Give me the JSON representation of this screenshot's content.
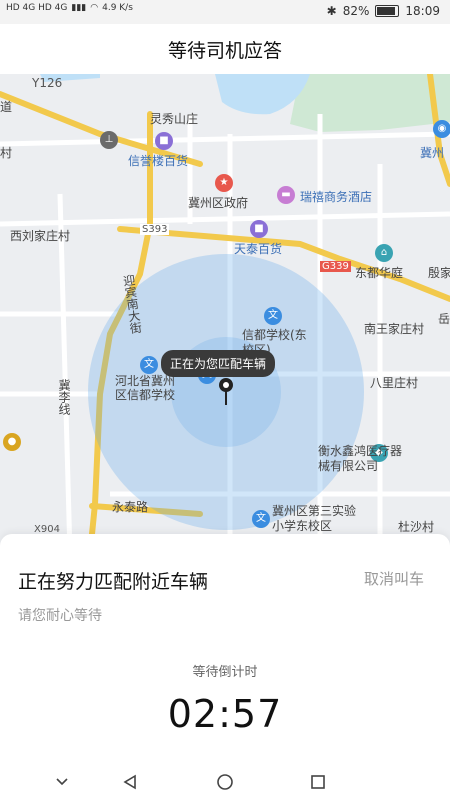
{
  "status_bar": {
    "network_left": "HD 4G HD 4G",
    "speed": "4.9 K/s",
    "battery_percent": "82%",
    "battery_level": 0.82,
    "time": "18:09"
  },
  "header": {
    "title": "等待司机应答"
  },
  "map": {
    "tooltip": "正在为您匹配车辆",
    "labels": [
      {
        "text": "Y126",
        "cls": "road"
      },
      {
        "text": "灵秀山庄",
        "cls": "dark"
      },
      {
        "text": "信誉楼百货",
        "cls": "blue"
      },
      {
        "text": "冀州区政府",
        "cls": "dark"
      },
      {
        "text": "瑞禧商务酒店",
        "cls": "blue"
      },
      {
        "text": "西刘家庄村",
        "cls": "dark"
      },
      {
        "text": "S393",
        "cls": "road"
      },
      {
        "text": "天泰百货",
        "cls": "blue"
      },
      {
        "text": "G339",
        "cls": "road"
      },
      {
        "text": "东都华庭",
        "cls": "dark"
      },
      {
        "text": "殷家",
        "cls": "dark"
      },
      {
        "text": "迎宾南大街",
        "cls": "dark"
      },
      {
        "text": "信都学校(东校区)",
        "cls": "dark"
      },
      {
        "text": "南王家庄村",
        "cls": "dark"
      },
      {
        "text": "河北省冀州区信都学校",
        "cls": "dark"
      },
      {
        "text": "八里庄村",
        "cls": "dark"
      },
      {
        "text": "冀李线",
        "cls": "dark"
      },
      {
        "text": "衡水鑫鸿医疗器械有限公司",
        "cls": "dark"
      },
      {
        "text": "永泰路",
        "cls": "dark"
      },
      {
        "text": "冀州区第三实验小学东校区",
        "cls": "dark"
      },
      {
        "text": "杜沙村",
        "cls": "dark"
      },
      {
        "text": "X904",
        "cls": "road"
      },
      {
        "text": "道",
        "cls": "dark"
      },
      {
        "text": "冀州",
        "cls": "blue"
      },
      {
        "text": "岳",
        "cls": "dark"
      },
      {
        "text": "村",
        "cls": "dark"
      }
    ]
  },
  "panel": {
    "title": "正在努力匹配附近车辆",
    "cancel_label": "取消叫车",
    "subtitle": "请您耐心等待",
    "countdown_label": "等待倒计时",
    "countdown": "02:57"
  },
  "navbar": {
    "items": [
      "chevron-down",
      "back",
      "home",
      "recents"
    ]
  },
  "colors": {
    "accent_blue": "#3b8de0",
    "road_yellow": "#f2c94c",
    "water": "#bfe0f7",
    "park": "#cfe8d4"
  }
}
